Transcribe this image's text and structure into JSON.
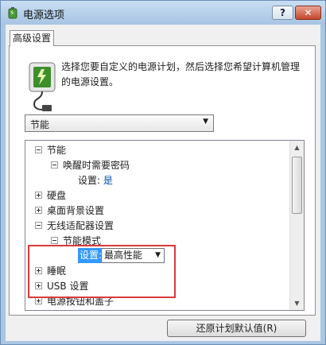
{
  "window": {
    "title": "电源选项",
    "help_label": "?",
    "close_label": "✕"
  },
  "tab": {
    "label": "高级设置"
  },
  "description": "选择您要自定义的电源计划，然后选择您希望计算机管理的电源设置。",
  "plan_select": {
    "value": "节能"
  },
  "tree": {
    "items": [
      {
        "label": "节能",
        "expanded": true
      },
      {
        "label": "唤醒时需要密码",
        "expanded": true
      },
      {
        "setting_label": "设置:",
        "value": "是"
      },
      {
        "label": "硬盘",
        "expanded": false
      },
      {
        "label": "桌面背景设置",
        "expanded": false
      },
      {
        "label": "无线适配器设置",
        "expanded": true
      },
      {
        "label": "节能模式",
        "expanded": true
      },
      {
        "setting_label": "设置:",
        "value": "最高性能"
      },
      {
        "label": "睡眠",
        "expanded": false
      },
      {
        "label": "USB 设置",
        "expanded": false
      },
      {
        "label": "电源按钮和盖子",
        "expanded": false
      }
    ]
  },
  "restore_button": {
    "label": "还原计划默认值(R)"
  },
  "colors": {
    "highlight_box": "#d93b3b",
    "selection": "#3399ff",
    "value_blue": "#0050a8"
  }
}
